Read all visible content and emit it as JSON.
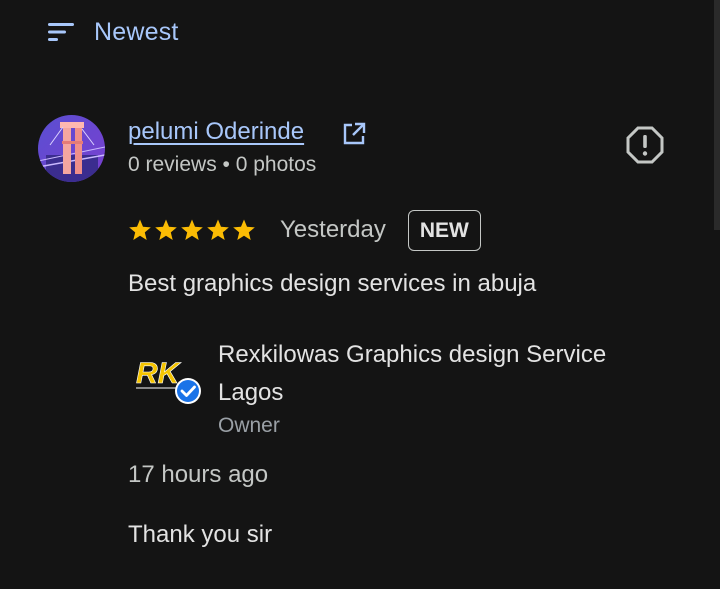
{
  "sort": {
    "label": "Newest",
    "icon": "sort-icon"
  },
  "review": {
    "reviewer_name": "pelumi Oderinde",
    "reviewer_meta": "0 reviews • 0 photos",
    "rating": 5,
    "date": "Yesterday",
    "badge": "NEW",
    "text": "Best graphics design services in abuja"
  },
  "owner_response": {
    "logo_text": "RK",
    "name": "Rexkilowas Graphics design Service Lagos",
    "role": "Owner",
    "time": "17 hours ago",
    "text": "Thank you sir"
  },
  "colors": {
    "background": "#141414",
    "link": "#a8c7fa",
    "star": "#fbbc04",
    "verified": "#1a73e8"
  }
}
